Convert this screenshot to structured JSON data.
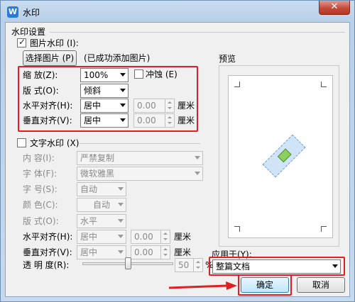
{
  "window": {
    "title": "水印",
    "close_symbol": "✕"
  },
  "section_title": "水印设置",
  "picture": {
    "checkbox_label": "图片水印",
    "shortcut": "(I):",
    "select_button": "选择图片",
    "select_shortcut": "(P)",
    "status": "(已成功添加图片)",
    "zoom_label": "缩    放(Z):",
    "zoom_value": "100%",
    "washout_label": "冲蚀",
    "washout_shortcut": "(E)",
    "layout_label": "版    式(O):",
    "layout_value": "倾斜",
    "halign_label": "水平对齐(H):",
    "halign_value": "居中",
    "halign_offset": "0.00",
    "valign_label": "垂直对齐(V):",
    "valign_value": "居中",
    "valign_offset": "0.00",
    "unit": "厘米"
  },
  "text": {
    "checkbox_label": "文字水印",
    "shortcut": "(X)",
    "content_label": "内    容(I):",
    "content_value": "严禁复制",
    "font_label": "字    体(F):",
    "font_value": "微软雅黑",
    "size_label": "字    号(S):",
    "size_value": "自动",
    "color_label": "颜    色(C):",
    "color_value": "自动",
    "layout_label": "版    式(O):",
    "layout_value": "水平",
    "halign_label": "水平对齐(H):",
    "halign_value": "居中",
    "halign_offset": "0.00",
    "valign_label": "垂直对齐(V):",
    "valign_value": "居中",
    "valign_offset": "0.00",
    "unit": "厘米",
    "transparency_label": "透 明 度(R):",
    "transparency_value": "50",
    "transparency_unit": "%",
    "transparency_level": 0.5
  },
  "preview": {
    "label": "预览"
  },
  "apply": {
    "label": "应用于(Y):",
    "value": "整篇文档"
  },
  "buttons": {
    "ok": "确定",
    "cancel": "取消"
  },
  "colors": {
    "highlight": "#e02020",
    "accent": "#2b79d8"
  }
}
